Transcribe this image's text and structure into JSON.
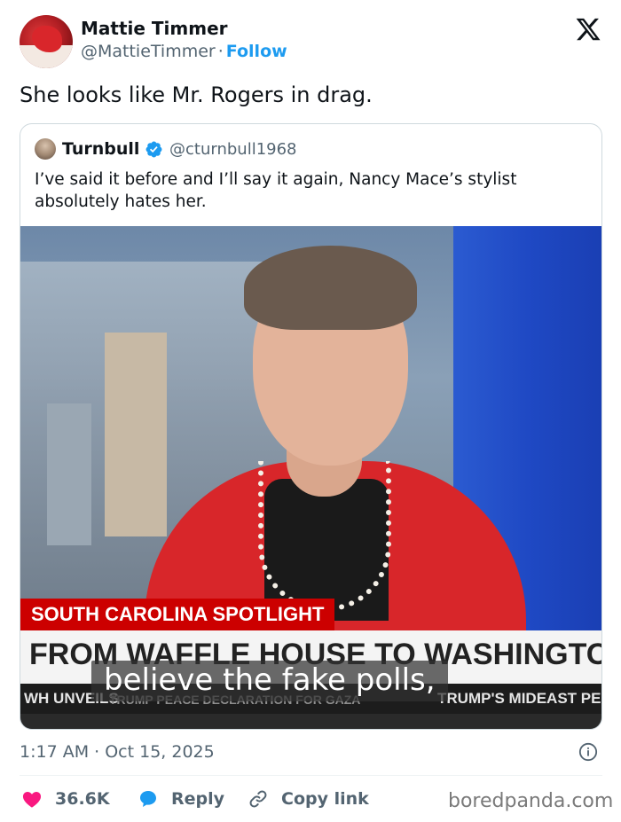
{
  "tweet": {
    "author": {
      "name": "Mattie Timmer",
      "handle": "@MattieTimmer",
      "separator": "·",
      "follow_label": "Follow"
    },
    "text": "She looks like Mr. Rogers in drag.",
    "timestamp": "1:17 AM · Oct 15, 2025"
  },
  "quote": {
    "author": {
      "name": "Turnbull",
      "handle": "@cturnbull1968"
    },
    "text": "I’ve said it before and I’ll say it again, Nancy Mace’s stylist absolutely hates her.",
    "media": {
      "lower_third_tag": "SOUTH CAROLINA SPOTLIGHT",
      "lower_third_headline": "FROM WAFFLE HOUSE TO WASHINGTON",
      "ticker_left": "WH UNVEILS",
      "ticker_mid": "TRUMP PEACE DECLARATION FOR GAZA",
      "ticker_right": "TRUMP'S MIDEAST PEA",
      "caption": "believe the fake polls,"
    }
  },
  "actions": {
    "like_count": "36.6K",
    "reply_label": "Reply",
    "copy_label": "Copy link"
  },
  "watermark": "boredpanda.com",
  "colors": {
    "accent": "#1d9bf0",
    "like": "#f91880",
    "muted": "#536471",
    "news_red": "#cc0000"
  }
}
